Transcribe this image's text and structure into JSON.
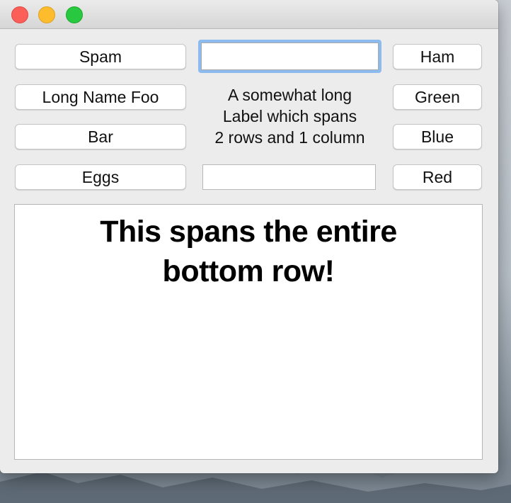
{
  "window": {
    "controls": {
      "close_color": "#fc5f57",
      "minimize_color": "#fdbc2e",
      "zoom_color": "#28c840"
    }
  },
  "grid": {
    "left_buttons": [
      "Spam",
      "Long Name Foo",
      "Bar",
      "Eggs"
    ],
    "right_buttons": [
      "Ham",
      "Green",
      "Blue",
      "Red"
    ],
    "top_entry": {
      "value": "",
      "placeholder": ""
    },
    "bottom_entry": {
      "value": "",
      "placeholder": ""
    },
    "span_label": "A somewhat long\nLabel which spans\n2 rows and 1 column"
  },
  "bottom_panel": {
    "text": "This spans the entire\nbottom row!"
  },
  "colors": {
    "focus_ring": "#8cbcef",
    "window_bg": "#ececec"
  }
}
